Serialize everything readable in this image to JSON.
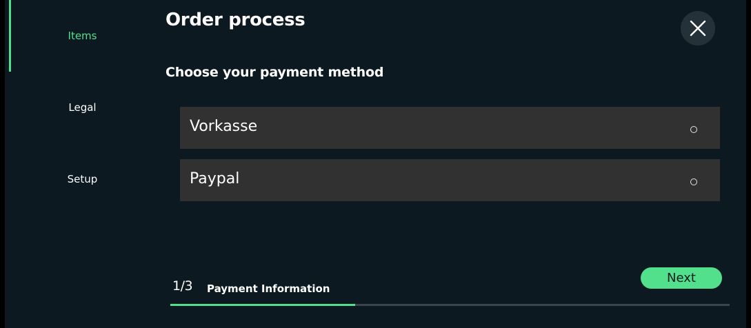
{
  "sidebar": {
    "items": [
      {
        "label": "Items",
        "active": true
      },
      {
        "label": "Legal",
        "active": false
      },
      {
        "label": "Setup",
        "active": false
      }
    ]
  },
  "header": {
    "title": "Order process",
    "close_icon": "close-icon"
  },
  "payment": {
    "heading": "Choose your payment method",
    "options": [
      {
        "label": "Vorkasse",
        "selected": false
      },
      {
        "label": "Paypal",
        "selected": false
      }
    ]
  },
  "footer": {
    "step_count": "1/3",
    "step_label": "Payment Information",
    "next_label": "Next",
    "progress_fraction": 0.33
  },
  "colors": {
    "accent": "#52e08c",
    "background": "#0d1920",
    "option_background": "#313131",
    "track": "#3b464c"
  }
}
